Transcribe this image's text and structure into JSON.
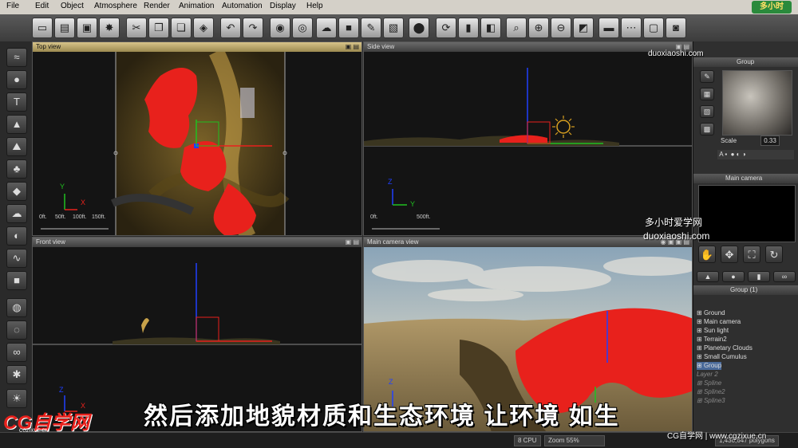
{
  "menu": [
    "File",
    "Edit",
    "Object",
    "Atmosphere",
    "Render",
    "Animation",
    "Automation",
    "Display",
    "Help"
  ],
  "logo_top": "多小时",
  "watermarks": {
    "top_url": "duoxiaoshi.com",
    "mid_cn": "多小时爱学网",
    "mid_url": "duoxiaoshi.com",
    "bottom": "CG自学网 | www.cgzixue.cn",
    "logo_cg": "CG自学网",
    "logo_sub": "CGZIXUE.CN"
  },
  "viewports": {
    "top": {
      "title": "Top view",
      "axis_y": "Y",
      "axis_x": "X",
      "scale_labels": [
        "0ft.",
        "50ft.",
        "100ft.",
        "150ft."
      ]
    },
    "side": {
      "title": "Side view",
      "axis_z": "Z",
      "axis_y": "Y",
      "scale_labels": [
        "0ft.",
        "500ft."
      ]
    },
    "front": {
      "title": "Front view",
      "axis_z": "Z",
      "axis_x": "X"
    },
    "camera": {
      "title": "Main camera view",
      "axis_z": "Z"
    }
  },
  "right_panel": {
    "material_title": "Group",
    "scale_label": "Scale",
    "scale_value": "0.33",
    "camera_title": "Main camera",
    "tree_title": "Group (1)",
    "tree_items": [
      {
        "label": "Ground",
        "dim": false
      },
      {
        "label": "Main camera",
        "dim": false
      },
      {
        "label": "Sun light",
        "dim": false
      },
      {
        "label": "Terrain2",
        "dim": false
      },
      {
        "label": "Planetary Clouds",
        "dim": false
      },
      {
        "label": "Small Cumulus",
        "dim": false
      },
      {
        "label": "Group",
        "dim": false
      },
      {
        "label": "Layer 2",
        "dim": true
      },
      {
        "label": "Spline",
        "dim": true
      },
      {
        "label": "Spline2",
        "dim": true
      },
      {
        "label": "Spline3",
        "dim": true
      }
    ]
  },
  "status": {
    "cpu": "8 CPU",
    "zoom": "Zoom 55%",
    "polygons": "1,430,647 polygons"
  },
  "subtitle": "然后添加地貌材质和生态环境 让环境    如生",
  "colors": {
    "accent_red": "#e8211c",
    "gizmo_blue": "#2040ff",
    "gizmo_green": "#20c020"
  }
}
